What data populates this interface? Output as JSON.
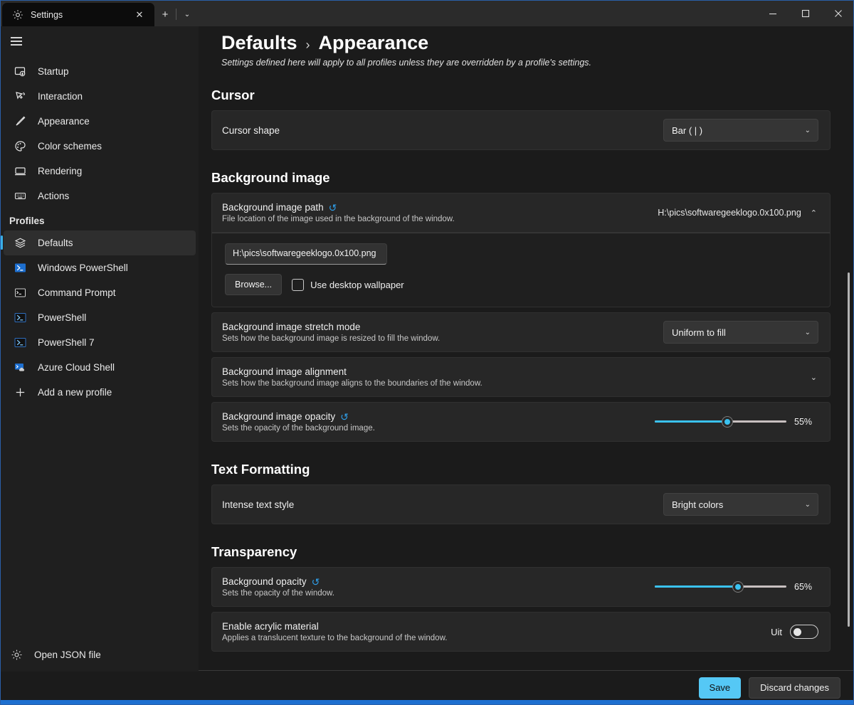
{
  "window": {
    "tab": {
      "title": "Settings",
      "icon": "gear-icon",
      "close": "✕"
    },
    "new_tab": "+",
    "tab_dropdown": "⌄",
    "controls": {
      "minimize": "–",
      "maximize": "□",
      "close": "✕"
    }
  },
  "sidebar": {
    "menu_icon": "hamburger-icon",
    "items": [
      {
        "label": "Startup",
        "icon": "startup-icon"
      },
      {
        "label": "Interaction",
        "icon": "interaction-icon"
      },
      {
        "label": "Appearance",
        "icon": "brush-icon"
      },
      {
        "label": "Color schemes",
        "icon": "palette-icon"
      },
      {
        "label": "Rendering",
        "icon": "monitor-icon"
      },
      {
        "label": "Actions",
        "icon": "keyboard-icon"
      }
    ],
    "profiles_header": "Profiles",
    "profiles": [
      {
        "label": "Defaults",
        "icon": "layers-icon",
        "selected": true
      },
      {
        "label": "Windows PowerShell",
        "icon": "powershell-icon",
        "selected": false
      },
      {
        "label": "Command Prompt",
        "icon": "cmd-icon",
        "selected": false
      },
      {
        "label": "PowerShell",
        "icon": "powershell-icon",
        "selected": false
      },
      {
        "label": "PowerShell 7",
        "icon": "powershell-icon",
        "selected": false
      },
      {
        "label": "Azure Cloud Shell",
        "icon": "azure-icon",
        "selected": false
      },
      {
        "label": "Add a new profile",
        "icon": "plus-icon",
        "selected": false
      }
    ],
    "open_json": {
      "label": "Open JSON file",
      "icon": "gear-icon"
    }
  },
  "header": {
    "breadcrumb_parent": "Defaults",
    "breadcrumb_separator": "›",
    "breadcrumb_current": "Appearance",
    "subtitle": "Settings defined here will apply to all profiles unless they are overridden by a profile's settings."
  },
  "sections": {
    "cursor": {
      "title": "Cursor",
      "cursor_shape": {
        "label": "Cursor shape",
        "value": "Bar ( | )"
      }
    },
    "background_image": {
      "title": "Background image",
      "path": {
        "label": "Background image path",
        "description": "File location of the image used in the background of the window.",
        "summary_value": "H:\\pics\\softwaregeeklogo.0x100.png",
        "expander_chevron": "⌃",
        "reset_icon": "↺",
        "textbox_value": "H:\\pics\\softwaregeeklogo.0x100.png",
        "browse_label": "Browse...",
        "wallpaper_label": "Use desktop wallpaper",
        "wallpaper_checked": false
      },
      "stretch_mode": {
        "label": "Background image stretch mode",
        "description": "Sets how the background image is resized to fill the window.",
        "value": "Uniform to fill"
      },
      "alignment": {
        "label": "Background image alignment",
        "description": "Sets how the background image aligns to the boundaries of the window.",
        "chevron": "⌄"
      },
      "opacity": {
        "label": "Background image opacity",
        "description": "Sets the opacity of the background image.",
        "reset_icon": "↺",
        "value": 55,
        "value_text": "55%"
      }
    },
    "text_formatting": {
      "title": "Text Formatting",
      "intense_text_style": {
        "label": "Intense text style",
        "value": "Bright colors"
      }
    },
    "transparency": {
      "title": "Transparency",
      "background_opacity": {
        "label": "Background opacity",
        "description": "Sets the opacity of the window.",
        "reset_icon": "↺",
        "value": 65,
        "value_text": "65%"
      },
      "acrylic": {
        "label": "Enable acrylic material",
        "description": "Applies a translucent texture to the background of the window.",
        "toggle_state_label": "Uit",
        "toggle_on": false
      }
    }
  },
  "footer": {
    "save_label": "Save",
    "discard_label": "Discard changes"
  },
  "colors": {
    "accent": "#3ac2f0",
    "save_button": "#55c8f5",
    "selection_bar": "#3ab0e8",
    "reset_link": "#2f9ee8"
  }
}
